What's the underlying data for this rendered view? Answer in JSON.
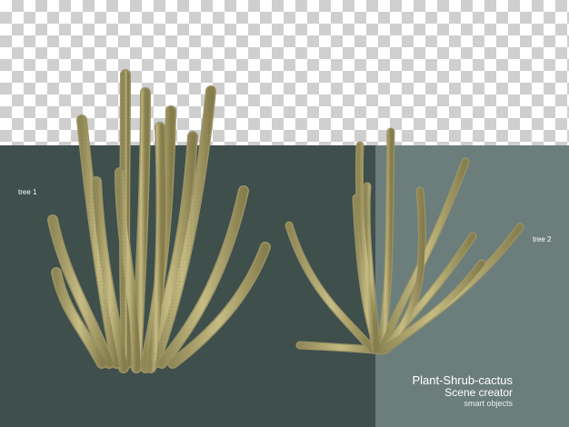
{
  "labels": {
    "tree1": "tree 1",
    "tree2": "tree 2"
  },
  "caption": {
    "title": "Plant-Shrub-cactus",
    "subtitle": "Scene creator",
    "small": "smart objects"
  },
  "colors": {
    "background_left": "#3e4f4c",
    "background_right": "#6b7e7c",
    "cactus": "#b7ae78"
  }
}
